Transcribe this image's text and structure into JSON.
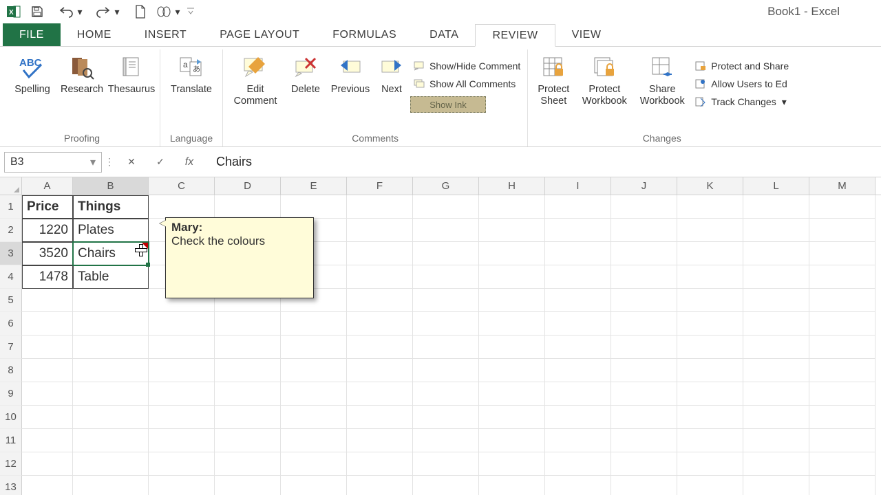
{
  "window_title": "Book1 - Excel",
  "tabs": {
    "file": "FILE",
    "home": "HOME",
    "insert": "INSERT",
    "page_layout": "PAGE LAYOUT",
    "formulas": "FORMULAS",
    "data": "DATA",
    "review": "REVIEW",
    "view": "VIEW"
  },
  "ribbon": {
    "proofing": {
      "label": "Proofing",
      "spelling": "Spelling",
      "research": "Research",
      "thesaurus": "Thesaurus"
    },
    "language": {
      "label": "Language",
      "translate": "Translate"
    },
    "comments": {
      "label": "Comments",
      "edit": "Edit Comment",
      "delete": "Delete",
      "previous": "Previous",
      "next": "Next",
      "show_hide": "Show/Hide Comment",
      "show_all": "Show All Comments",
      "show_ink": "Show Ink"
    },
    "changes": {
      "label": "Changes",
      "protect_sheet": "Protect Sheet",
      "protect_workbook": "Protect Workbook",
      "share_workbook": "Share Workbook",
      "protect_share": "Protect and Share",
      "allow_users": "Allow Users to Ed",
      "track_changes": "Track Changes"
    }
  },
  "formula_bar": {
    "name_box": "B3",
    "value": "Chairs"
  },
  "columns": [
    "A",
    "B",
    "C",
    "D",
    "E",
    "F",
    "G",
    "H",
    "I",
    "J",
    "K",
    "L",
    "M"
  ],
  "rows_visible": 13,
  "selected_cell": {
    "row": 3,
    "col": "B"
  },
  "data_cells": {
    "A1": "Price",
    "B1": "Things",
    "A2": "1220",
    "B2": "Plates",
    "A3": "3520",
    "B3": "Chairs",
    "A4": "1478",
    "B4": "Table"
  },
  "comment": {
    "on_cell": "B3",
    "author": "Mary:",
    "text": "Check the colours"
  }
}
